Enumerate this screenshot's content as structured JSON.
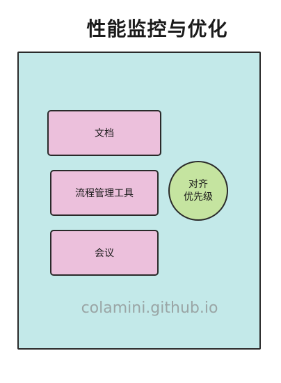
{
  "title": "性能监控与优化",
  "panel": {
    "color": "#c3e9e9",
    "items": [
      {
        "label": "文档",
        "color": "#ecc0dc"
      },
      {
        "label": "流程管理工具",
        "color": "#ecc0dc"
      },
      {
        "label": "会议",
        "color": "#ecc0dc"
      }
    ],
    "circle": {
      "line1": "对齐",
      "line2": "优先级",
      "color": "#c5e4a0"
    },
    "watermark": "colamini.github.io"
  }
}
